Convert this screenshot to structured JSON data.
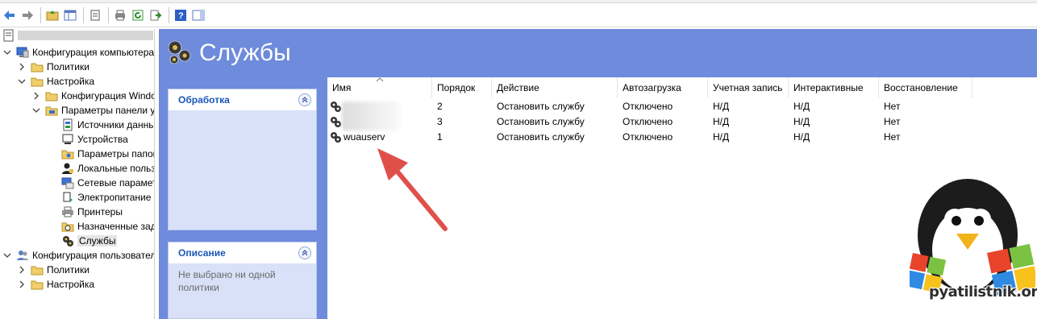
{
  "toolbar": {
    "buttons": [
      "back-icon",
      "forward-icon",
      "up-folder-icon",
      "show-hide-tree-icon",
      "properties-icon",
      "print-icon",
      "refresh-icon",
      "export-icon",
      "help-icon",
      "action-pane-icon"
    ]
  },
  "tree": {
    "items": [
      {
        "label": "Конфигурация компьютера",
        "level": 0,
        "expanded": true,
        "icon": "computer-icon"
      },
      {
        "label": "Политики",
        "level": 1,
        "expanded": false,
        "icon": "folder-icon"
      },
      {
        "label": "Настройка",
        "level": 1,
        "expanded": true,
        "icon": "folder-icon"
      },
      {
        "label": "Конфигурация Windows",
        "level": 2,
        "expanded": false,
        "icon": "folder-icon"
      },
      {
        "label": "Параметры панели управления",
        "level": 2,
        "expanded": true,
        "icon": "control-panel-icon"
      },
      {
        "label": "Источники данных",
        "level": 3,
        "icon": "data-sources-icon"
      },
      {
        "label": "Устройства",
        "level": 3,
        "icon": "devices-icon"
      },
      {
        "label": "Параметры папок",
        "level": 3,
        "icon": "folder-options-icon"
      },
      {
        "label": "Локальные пользователи",
        "level": 3,
        "icon": "local-users-icon"
      },
      {
        "label": "Сетевые параметры",
        "level": 3,
        "icon": "network-icon"
      },
      {
        "label": "Электропитание",
        "level": 3,
        "icon": "power-icon"
      },
      {
        "label": "Принтеры",
        "level": 3,
        "icon": "printer-icon"
      },
      {
        "label": "Назначенные задания",
        "level": 3,
        "icon": "scheduled-tasks-icon"
      },
      {
        "label": "Службы",
        "level": 3,
        "icon": "services-icon",
        "selected": true
      },
      {
        "label": "Конфигурация пользователя",
        "level": 0,
        "expanded": true,
        "icon": "user-config-icon"
      },
      {
        "label": "Политики",
        "level": 1,
        "expanded": false,
        "icon": "folder-icon"
      },
      {
        "label": "Настройка",
        "level": 1,
        "expanded": false,
        "icon": "folder-icon"
      }
    ]
  },
  "pane": {
    "title": "Службы",
    "processing_card": {
      "title": "Обработка"
    },
    "description_card": {
      "title": "Описание",
      "text": "Не выбрано ни одной политики"
    }
  },
  "list": {
    "columns": [
      "Имя",
      "Порядок",
      "Действие",
      "Автозагрузка",
      "Учетная запись",
      "Интерактивные",
      "Восстановление"
    ],
    "rows": [
      {
        "name": "",
        "order": "2",
        "action": "Остановить службу",
        "startup": "Отключено",
        "account": "Н/Д",
        "interactive": "Н/Д",
        "recovery": "Нет"
      },
      {
        "name": "",
        "order": "3",
        "action": "Остановить службу",
        "startup": "Отключено",
        "account": "Н/Д",
        "interactive": "Н/Д",
        "recovery": "Нет"
      },
      {
        "name": "wuauserv",
        "order": "1",
        "action": "Остановить службу",
        "startup": "Отключено",
        "account": "Н/Д",
        "interactive": "Н/Д",
        "recovery": "Нет"
      }
    ]
  },
  "watermark": {
    "text": "pyatilistnik.org"
  },
  "colors": {
    "pane_bg": "#6e8bdc",
    "card_bg": "#d8e1f7",
    "card_title": "#1a57b8",
    "arrow": "#e0504a"
  }
}
